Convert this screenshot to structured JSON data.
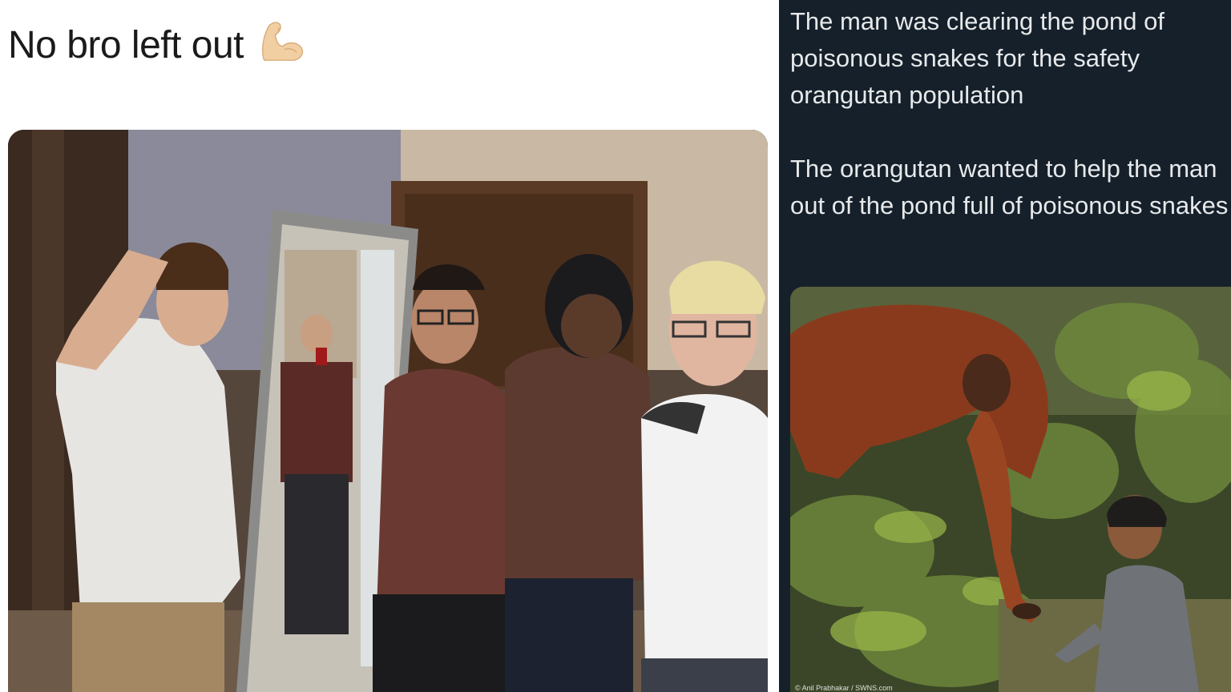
{
  "left_meme": {
    "caption": "No bro left out",
    "emoji": "flexed-biceps-icon"
  },
  "right_meme": {
    "paragraph_1": "The man was clearing the pond of poisonous snakes for the safety orangutan population",
    "paragraph_2": "The orangutan wanted to help the man out of the pond full of poisonous snakes",
    "photo_credit": "© Anil Prabhakar / SWNS.com"
  },
  "colors": {
    "left_background": "#ffffff",
    "right_background": "#15202b",
    "right_text": "#e7e9ea",
    "left_text": "#1a1a1a"
  }
}
